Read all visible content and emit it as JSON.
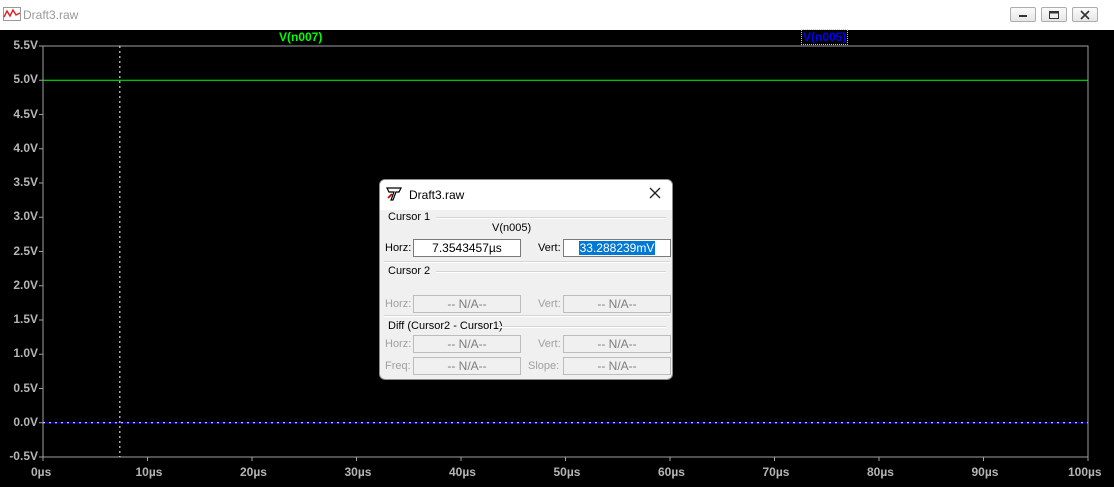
{
  "window": {
    "title": "Draft3.raw"
  },
  "plot": {
    "y_ticks": [
      "5.5V",
      "5.0V",
      "4.5V",
      "4.0V",
      "3.5V",
      "3.0V",
      "2.5V",
      "2.0V",
      "1.5V",
      "1.0V",
      "0.5V",
      "0.0V",
      "-0.5V"
    ],
    "x_ticks": [
      "0µs",
      "10µs",
      "20µs",
      "30µs",
      "40µs",
      "50µs",
      "60µs",
      "70µs",
      "80µs",
      "90µs",
      "100µs"
    ],
    "traces": [
      {
        "name": "V(n007)",
        "color": "#00ff00",
        "value": 5.0
      },
      {
        "name": "V(n005)",
        "color": "#0000ff",
        "value": 0.0
      }
    ],
    "cursor_time": "7.3543457µs"
  },
  "dialog": {
    "title": "Draft3.raw",
    "cursor1": {
      "label": "Cursor 1",
      "trace": "V(n005)",
      "horz_label": "Horz:",
      "horz_value": "7.3543457µs",
      "vert_label": "Vert:",
      "vert_value": "33.288239mV"
    },
    "cursor2": {
      "label": "Cursor 2",
      "horz_label": "Horz:",
      "horz_value": "-- N/A--",
      "vert_label": "Vert:",
      "vert_value": "-- N/A--"
    },
    "diff": {
      "label": "Diff (Cursor2 - Cursor1)",
      "horz_label": "Horz:",
      "horz_value": "-- N/A--",
      "vert_label": "Vert:",
      "vert_value": "-- N/A--",
      "freq_label": "Freq:",
      "freq_value": "-- N/A--",
      "slope_label": "Slope:",
      "slope_value": "-- N/A--"
    }
  }
}
